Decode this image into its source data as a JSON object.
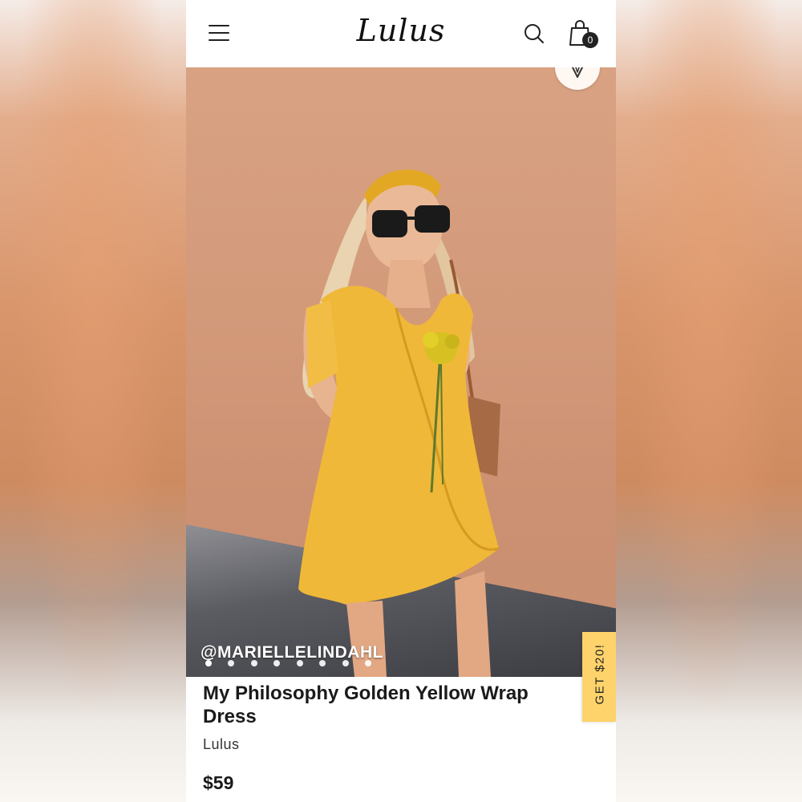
{
  "header": {
    "logo": "Lulus",
    "menu_icon": "hamburger-menu-icon",
    "search_icon": "search-icon",
    "bag_icon": "shopping-bag-icon",
    "bag_count": "0"
  },
  "hero": {
    "credit": "@MARIELLELINDAHL",
    "pin_icon": "pin-icon",
    "carousel_count": 8
  },
  "promo": {
    "label": "GET $20!"
  },
  "product": {
    "title": "My Philosophy Golden Yellow Wrap Dress",
    "brand": "Lulus",
    "price": "$59"
  },
  "colors": {
    "promo_bg": "#ffd36b",
    "text": "#1a1a1a",
    "dress": "#f0b838"
  }
}
